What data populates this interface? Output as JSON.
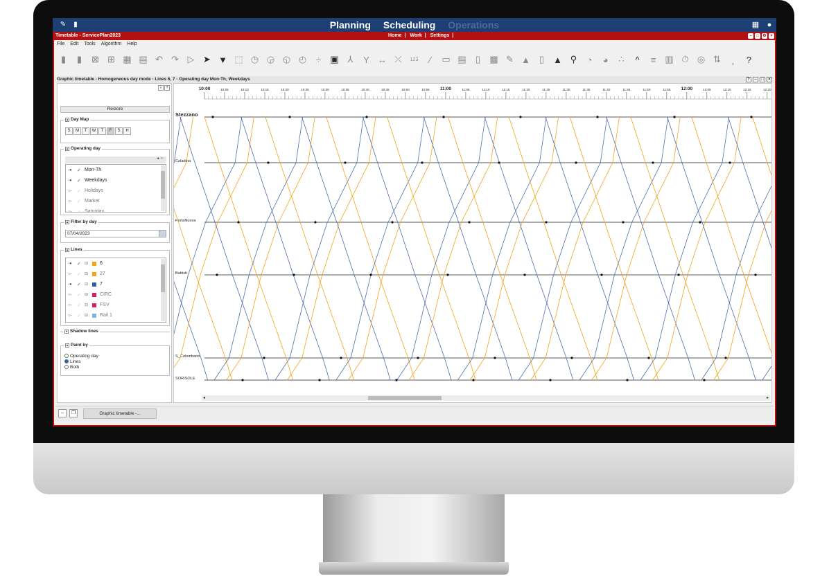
{
  "nav": {
    "tabs": [
      {
        "label": "Planning",
        "dim": false
      },
      {
        "label": "Scheduling",
        "dim": false
      },
      {
        "label": "Operations",
        "dim": true
      }
    ],
    "icon_names": [
      "pen-compass-icon",
      "bus-icon",
      "apps-grid-icon",
      "user-icon"
    ]
  },
  "window": {
    "title": "Timetable - ServicePlan2023",
    "links": [
      "Home",
      "Work",
      "Settings"
    ]
  },
  "menu": [
    "File",
    "Edit",
    "Tools",
    "Algorithm",
    "Help"
  ],
  "toolbar_icons": [
    "save-icon",
    "save-as-icon",
    "view-icon",
    "grid-icon",
    "calendar-view-icon",
    "form-icon",
    "undo-icon",
    "redo-icon",
    "select-icon",
    "pointer-icon",
    "filter-icon",
    "marquee-icon",
    "clock-a-icon",
    "clock-b-icon",
    "clock-c-icon",
    "clock-d-icon",
    "divide-icon",
    "bus-icon",
    "branch-icon",
    "fork-icon",
    "arrows-icon",
    "cross-icon",
    "numbers-icon",
    "pencil-icon",
    "calendar-icon",
    "list-icon",
    "map-icon",
    "vehicle-icon",
    "link-icon",
    "chart-icon",
    "copy-icon",
    "warning-icon",
    "pin-icon",
    "gauge-a-icon",
    "gauge-b-icon",
    "people-icon",
    "chevron-up-icon",
    "stack-icon",
    "clipboard-icon",
    "stopwatch-icon",
    "dial-icon",
    "signal-icon",
    "sort-icon",
    "help-icon"
  ],
  "toolbar_glyphs": [
    "▮",
    "▮",
    "⊠",
    "⊞",
    "▦",
    "▤",
    "↶",
    "↷",
    "▷",
    "➤",
    "▼",
    "⬚",
    "◷",
    "◶",
    "◵",
    "◴",
    "÷",
    "▣",
    "⅄",
    "Y",
    "↔",
    "⤫",
    "123",
    "∕",
    "▭",
    "▤",
    "▯",
    "▩",
    "✎",
    "▲",
    "▯",
    "▲",
    "⚲",
    "◔",
    "◕",
    "∴",
    "^",
    "≡",
    "▥",
    "⏱",
    "◎",
    "⇅",
    "¸",
    "?"
  ],
  "subwindow_title": "Graphic timetable - Homogeneous day mode - Lines 6, 7 - Operating day Mon-Th, Weekdays",
  "left_panel": {
    "restore": "Restore",
    "day_map": {
      "title": "Day Map",
      "days": [
        "S",
        "M",
        "T",
        "W",
        "T",
        "F",
        "S",
        "H"
      ],
      "selected_index": 5
    },
    "operating_day": {
      "title": "Operating day",
      "header_icons": [
        "-●",
        "○-"
      ],
      "items": [
        {
          "label": "Mon-Th",
          "key": "-●",
          "checked": true
        },
        {
          "label": "Weekdays",
          "key": "-●",
          "checked": true
        },
        {
          "label": "Holidays",
          "key": "○-",
          "checked": false
        },
        {
          "label": "Market",
          "key": "○-",
          "checked": false
        },
        {
          "label": "Saturday",
          "key": "○-",
          "checked": false
        }
      ]
    },
    "filter_by_day": {
      "title": "Filter by day",
      "date": "07/04/2023"
    },
    "lines": {
      "title": "Lines",
      "items": [
        {
          "label": "6",
          "color": "#f3a21a",
          "key": "-●",
          "checked": true
        },
        {
          "label": "27",
          "color": "#f3a21a",
          "key": "○-",
          "checked": false
        },
        {
          "label": "7",
          "color": "#2f5ea8",
          "key": "-●",
          "checked": true
        },
        {
          "label": "CIRC",
          "color": "#d5235a",
          "key": "○-",
          "checked": false
        },
        {
          "label": "FSV",
          "color": "#d5235a",
          "key": "○-",
          "checked": false
        },
        {
          "label": "Rail 1",
          "color": "#7fb3d9",
          "key": "○-",
          "checked": false
        }
      ]
    },
    "shadow_lines": {
      "title": "Shadow lines"
    },
    "paint_by": {
      "title": "Paint by",
      "options": [
        "Operating day",
        "Lines",
        "Both"
      ],
      "selected_index": 1
    }
  },
  "chart_data": {
    "type": "line",
    "title": "",
    "time_axis_start": "10:00",
    "time_axis_end": "12:20",
    "tick_labels": [
      "10:00",
      "10:05",
      "10:10",
      "10:15",
      "10:20",
      "10:25",
      "10:30",
      "10:35",
      "10:40",
      "10:45",
      "10:50",
      "10:55",
      "11:00",
      "11:05",
      "11:10",
      "11:15",
      "11:20",
      "11:25",
      "11:30",
      "11:35",
      "11:40",
      "11:45",
      "11:50",
      "11:55",
      "12:00",
      "12:05",
      "12:10",
      "12:15",
      "12:20"
    ],
    "bold_tick_labels": [
      "10:00",
      "11:00",
      "12:00"
    ],
    "stations": [
      "Stezzano",
      "Celadina",
      "PortaNuova",
      "Battisti",
      "S_Colombano",
      "SORISOLE"
    ],
    "series": [
      {
        "name": "6",
        "color": "#f3a21a"
      },
      {
        "name": "7",
        "color": "#4a6fb0"
      }
    ]
  },
  "bottom": {
    "tab_label": "Graphic timetable -..."
  }
}
